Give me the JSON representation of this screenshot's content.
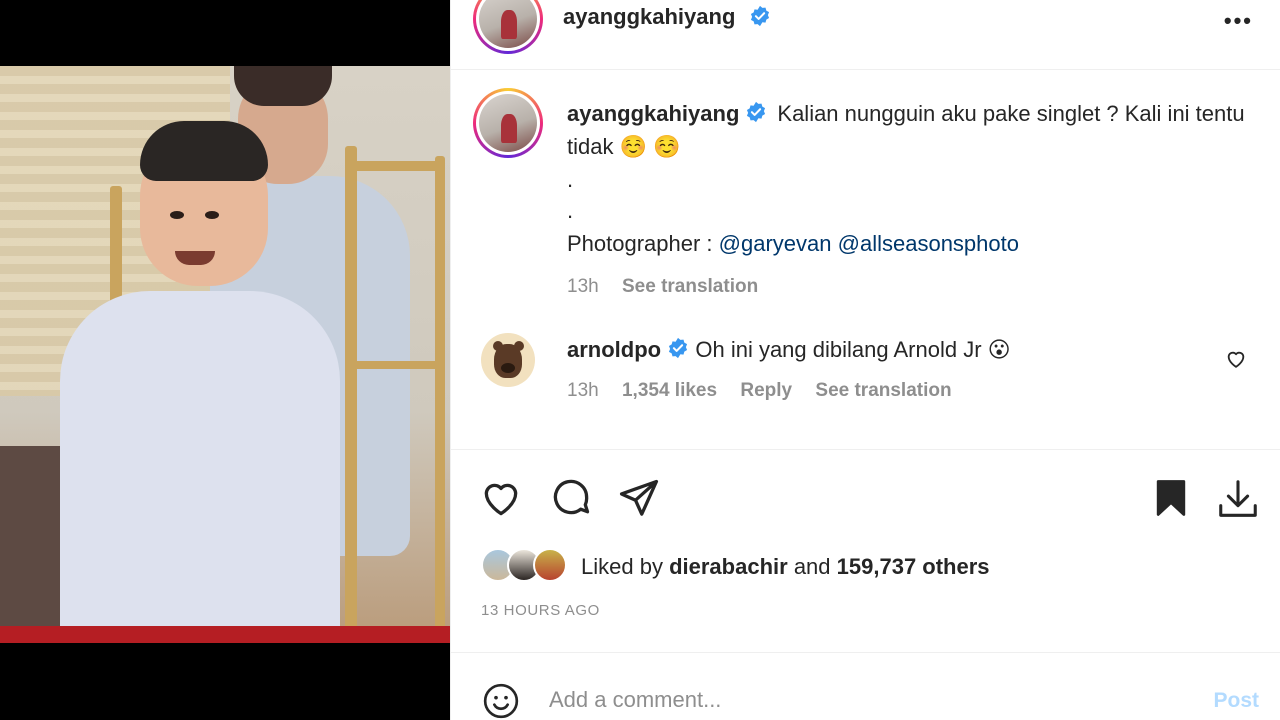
{
  "post": {
    "image_alt": "Photo of a smiling young boy in a light blue outfit, with a smiling woman and gold chairs in the background"
  },
  "header": {
    "username": "ayanggkahiyang",
    "more_label": "•••"
  },
  "caption": {
    "username": "ayanggkahiyang",
    "text": "Kalian nungguin aku pake singlet ? Kali ini tentu tidak ☺️ ☺️",
    "dot1": ".",
    "dot2": ".",
    "photographer_label": "Photographer :",
    "mention1": "@garyevan",
    "mention2": "@allseasonsphoto",
    "time": "13h",
    "see_translation": "See translation"
  },
  "comment": {
    "username": "arnoldpo",
    "text": "Oh ini yang dibilang Arnold Jr",
    "emoji": "😮",
    "time": "13h",
    "likes": "1,354 likes",
    "reply": "Reply",
    "see_translation": "See translation"
  },
  "likes": {
    "prefix": "Liked by",
    "user": "dierabachir",
    "and": "and",
    "others": "159,737 others"
  },
  "time_ago": "13 HOURS AGO",
  "comment_box": {
    "placeholder": "Add a comment...",
    "post_label": "Post"
  },
  "colors": {
    "verified": "#3897f0",
    "link": "#00376b",
    "muted": "#8e8e8e",
    "post_disabled": "#b3dbff"
  }
}
